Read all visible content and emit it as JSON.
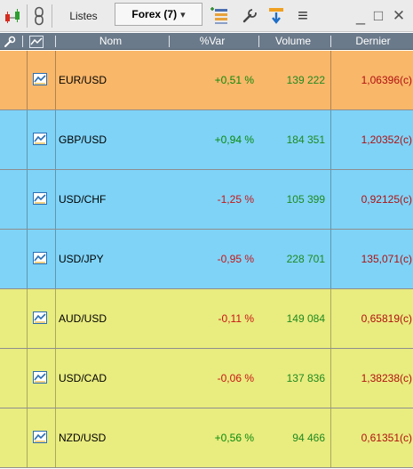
{
  "toolbar": {
    "lists_label": "Listes",
    "list_select_value": "Forex (7)",
    "minimize_glyph": "_",
    "restore_glyph": "□",
    "close_glyph": "✕",
    "menu_glyph": "≡",
    "dropdown_glyph": "▾",
    "icons": [
      "buy-sell-icon",
      "link-icon",
      "column-settings-icon",
      "wrench-icon",
      "filter-icon",
      "menu-icon",
      "minimize-icon",
      "restore-icon",
      "close-icon"
    ]
  },
  "table": {
    "columns": {
      "settings_glyph": "🔧",
      "nom": "Nom",
      "var": "%Var",
      "volume": "Volume",
      "dernier": "Dernier"
    },
    "rows": [
      {
        "name": "EUR/USD",
        "var": "+0,51 %",
        "volume": "139 222",
        "last": "1,06396(c)",
        "bg": "#f9b76a",
        "trend": "up"
      },
      {
        "name": "GBP/USD",
        "var": "+0,94 %",
        "volume": "184 351",
        "last": "1,20352(c)",
        "bg": "#7fd3f7",
        "trend": "up"
      },
      {
        "name": "USD/CHF",
        "var": "-1,25 %",
        "volume": "105 399",
        "last": "0,92125(c)",
        "bg": "#7fd3f7",
        "trend": "down"
      },
      {
        "name": "USD/JPY",
        "var": "-0,95 %",
        "volume": "228 701",
        "last": "135,071(c)",
        "bg": "#7fd3f7",
        "trend": "down"
      },
      {
        "name": "AUD/USD",
        "var": "-0,11 %",
        "volume": "149 084",
        "last": "0,65819(c)",
        "bg": "#e9ec7f",
        "trend": "down"
      },
      {
        "name": "USD/CAD",
        "var": "-0,06 %",
        "volume": "137 836",
        "last": "1,38238(c)",
        "bg": "#e9ec7f",
        "trend": "down"
      },
      {
        "name": "NZD/USD",
        "var": "+0,56 %",
        "volume": "94 466",
        "last": "0,61351(c)",
        "bg": "#e9ec7f",
        "trend": "up"
      }
    ]
  },
  "colors": {
    "positive": "#0a8a0a",
    "negative": "#c81414",
    "header_bg": "#6b7a8a",
    "toolbar_bg": "#ebebeb"
  }
}
